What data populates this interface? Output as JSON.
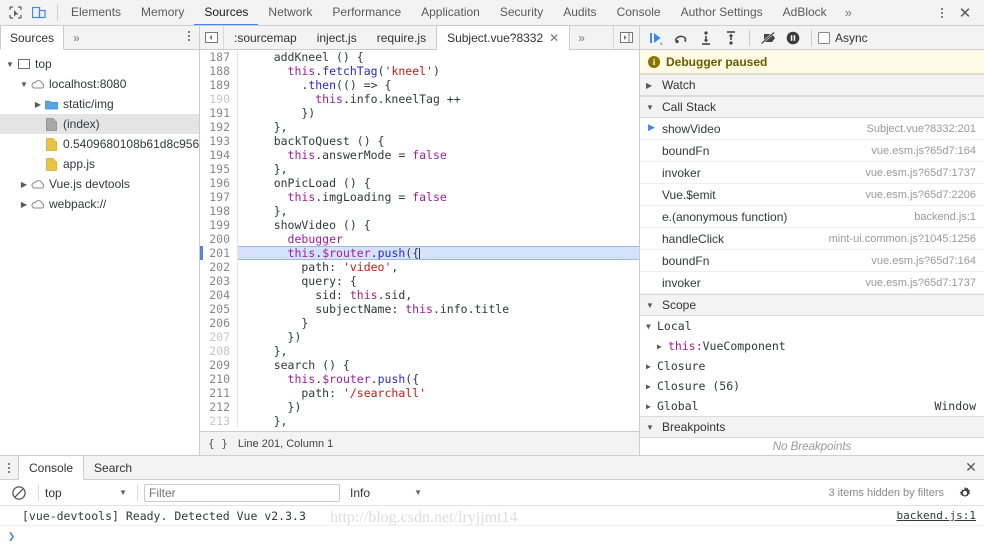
{
  "topbar": {
    "icons": [
      {
        "name": "inspect-element-icon",
        "glyph": "inspect"
      },
      {
        "name": "device-toolbar-icon",
        "glyph": "device"
      }
    ],
    "tabs": [
      {
        "label": "Elements",
        "active": false
      },
      {
        "label": "Memory",
        "active": false
      },
      {
        "label": "Sources",
        "active": true
      },
      {
        "label": "Network",
        "active": false
      },
      {
        "label": "Performance",
        "active": false
      },
      {
        "label": "Application",
        "active": false
      },
      {
        "label": "Security",
        "active": false
      },
      {
        "label": "Audits",
        "active": false
      },
      {
        "label": "Console",
        "active": false
      },
      {
        "label": "Author Settings",
        "active": false
      },
      {
        "label": "AdBlock",
        "active": false
      }
    ],
    "overflow_label": "»",
    "close_label": "✕"
  },
  "navigator": {
    "tabs": [
      {
        "label": "Sources",
        "active": true
      },
      {
        "label": "»",
        "active": false
      }
    ],
    "tree": [
      {
        "label": "top",
        "depth": 0,
        "twisty": "▼",
        "icon": "frame-icon",
        "selected": false
      },
      {
        "label": "localhost:8080",
        "depth": 1,
        "twisty": "▼",
        "icon": "cloud-icon",
        "selected": false
      },
      {
        "label": "static/img",
        "depth": 2,
        "twisty": "▶",
        "icon": "folder-blue-icon",
        "selected": false
      },
      {
        "label": "(index)",
        "depth": 2,
        "twisty": "",
        "icon": "document-gray-icon",
        "selected": true
      },
      {
        "label": "0.5409680108b61d8c956",
        "depth": 2,
        "twisty": "",
        "icon": "script-yellow-icon",
        "selected": false
      },
      {
        "label": "app.js",
        "depth": 2,
        "twisty": "",
        "icon": "script-yellow-icon",
        "selected": false
      },
      {
        "label": "Vue.js devtools",
        "depth": 1,
        "twisty": "▶",
        "icon": "cloud-icon",
        "selected": false
      },
      {
        "label": "webpack://",
        "depth": 1,
        "twisty": "▶",
        "icon": "cloud-icon",
        "selected": false
      }
    ]
  },
  "editor": {
    "tabs": [
      {
        "label": ":sourcemap",
        "active": false,
        "closable": false
      },
      {
        "label": "inject.js",
        "active": false,
        "closable": false
      },
      {
        "label": "require.js",
        "active": false,
        "closable": false
      },
      {
        "label": "Subject.vue?8332",
        "active": true,
        "closable": true
      }
    ],
    "tab_close_glyph": "✕",
    "tab_overflow_label": "»",
    "status": {
      "pretty_print_label": "{ }",
      "position_label": "Line 201, Column 1"
    },
    "lines": [
      {
        "n": 187,
        "dim": false,
        "hl": false,
        "tokens": [
          {
            "t": "    addKneel () {",
            "c": "kw"
          }
        ]
      },
      {
        "n": 188,
        "dim": false,
        "hl": false,
        "tokens": [
          {
            "t": "      ",
            "c": "kw"
          },
          {
            "t": "this",
            "c": "pp"
          },
          {
            "t": ".",
            "c": "kw"
          },
          {
            "t": "fetchTag",
            "c": "fn"
          },
          {
            "t": "(",
            "c": "kw"
          },
          {
            "t": "'kneel'",
            "c": "st"
          },
          {
            "t": ")",
            "c": "kw"
          }
        ]
      },
      {
        "n": 189,
        "dim": false,
        "hl": false,
        "tokens": [
          {
            "t": "        .",
            "c": "kw"
          },
          {
            "t": "then",
            "c": "fn"
          },
          {
            "t": "(() => {",
            "c": "kw"
          }
        ]
      },
      {
        "n": 190,
        "dim": true,
        "hl": false,
        "tokens": [
          {
            "t": "          ",
            "c": "kw"
          },
          {
            "t": "this",
            "c": "pp"
          },
          {
            "t": ".info.kneelTag ++",
            "c": "kw"
          }
        ]
      },
      {
        "n": 191,
        "dim": false,
        "hl": false,
        "tokens": [
          {
            "t": "        })",
            "c": "kw"
          }
        ]
      },
      {
        "n": 192,
        "dim": false,
        "hl": false,
        "tokens": [
          {
            "t": "    },",
            "c": "kw"
          }
        ]
      },
      {
        "n": 193,
        "dim": false,
        "hl": false,
        "tokens": [
          {
            "t": "    backToQuest () {",
            "c": "kw"
          }
        ]
      },
      {
        "n": 194,
        "dim": false,
        "hl": false,
        "tokens": [
          {
            "t": "      ",
            "c": "kw"
          },
          {
            "t": "this",
            "c": "pp"
          },
          {
            "t": ".answerMode = ",
            "c": "kw"
          },
          {
            "t": "false",
            "c": "pp"
          }
        ]
      },
      {
        "n": 195,
        "dim": false,
        "hl": false,
        "tokens": [
          {
            "t": "    },",
            "c": "kw"
          }
        ]
      },
      {
        "n": 196,
        "dim": false,
        "hl": false,
        "tokens": [
          {
            "t": "    onPicLoad () {",
            "c": "kw"
          }
        ]
      },
      {
        "n": 197,
        "dim": false,
        "hl": false,
        "tokens": [
          {
            "t": "      ",
            "c": "kw"
          },
          {
            "t": "this",
            "c": "pp"
          },
          {
            "t": ".imgLoading = ",
            "c": "kw"
          },
          {
            "t": "false",
            "c": "pp"
          }
        ]
      },
      {
        "n": 198,
        "dim": false,
        "hl": false,
        "tokens": [
          {
            "t": "    },",
            "c": "kw"
          }
        ]
      },
      {
        "n": 199,
        "dim": false,
        "hl": false,
        "tokens": [
          {
            "t": "    showVideo () {",
            "c": "kw"
          }
        ]
      },
      {
        "n": 200,
        "dim": false,
        "hl": false,
        "tokens": [
          {
            "t": "      ",
            "c": "kw"
          },
          {
            "t": "debugger",
            "c": "pp"
          }
        ]
      },
      {
        "n": 201,
        "dim": false,
        "hl": true,
        "tokens": [
          {
            "t": "      ",
            "c": "kw"
          },
          {
            "t": "this",
            "c": "pp"
          },
          {
            "t": ".",
            "c": "kw"
          },
          {
            "t": "$router",
            "c": "pp"
          },
          {
            "t": ".",
            "c": "kw"
          },
          {
            "t": "push",
            "c": "fn"
          },
          {
            "t": "({",
            "c": "kw"
          }
        ]
      },
      {
        "n": 202,
        "dim": false,
        "hl": false,
        "tokens": [
          {
            "t": "        path: ",
            "c": "kw"
          },
          {
            "t": "'video'",
            "c": "st"
          },
          {
            "t": ",",
            "c": "kw"
          }
        ]
      },
      {
        "n": 203,
        "dim": false,
        "hl": false,
        "tokens": [
          {
            "t": "        query: {",
            "c": "kw"
          }
        ]
      },
      {
        "n": 204,
        "dim": false,
        "hl": false,
        "tokens": [
          {
            "t": "          sid: ",
            "c": "kw"
          },
          {
            "t": "this",
            "c": "pp"
          },
          {
            "t": ".sid,",
            "c": "kw"
          }
        ]
      },
      {
        "n": 205,
        "dim": false,
        "hl": false,
        "tokens": [
          {
            "t": "          subjectName: ",
            "c": "kw"
          },
          {
            "t": "this",
            "c": "pp"
          },
          {
            "t": ".info.title",
            "c": "kw"
          }
        ]
      },
      {
        "n": 206,
        "dim": false,
        "hl": false,
        "tokens": [
          {
            "t": "        }",
            "c": "kw"
          }
        ]
      },
      {
        "n": 207,
        "dim": true,
        "hl": false,
        "tokens": [
          {
            "t": "      })",
            "c": "kw"
          }
        ]
      },
      {
        "n": 208,
        "dim": true,
        "hl": false,
        "tokens": [
          {
            "t": "    },",
            "c": "kw"
          }
        ]
      },
      {
        "n": 209,
        "dim": false,
        "hl": false,
        "tokens": [
          {
            "t": "    search () {",
            "c": "kw"
          }
        ]
      },
      {
        "n": 210,
        "dim": false,
        "hl": false,
        "tokens": [
          {
            "t": "      ",
            "c": "kw"
          },
          {
            "t": "this",
            "c": "pp"
          },
          {
            "t": ".",
            "c": "kw"
          },
          {
            "t": "$router",
            "c": "pp"
          },
          {
            "t": ".",
            "c": "kw"
          },
          {
            "t": "push",
            "c": "fn"
          },
          {
            "t": "({",
            "c": "kw"
          }
        ]
      },
      {
        "n": 211,
        "dim": false,
        "hl": false,
        "tokens": [
          {
            "t": "        path: ",
            "c": "kw"
          },
          {
            "t": "'/searchall'",
            "c": "st"
          }
        ]
      },
      {
        "n": 212,
        "dim": false,
        "hl": false,
        "tokens": [
          {
            "t": "      })",
            "c": "kw"
          }
        ]
      },
      {
        "n": 213,
        "dim": true,
        "hl": false,
        "tokens": [
          {
            "t": "    },",
            "c": "kw"
          }
        ]
      }
    ]
  },
  "debugger": {
    "toolbar": [
      {
        "name": "resume-script-button",
        "title": "Resume script execution"
      },
      {
        "name": "step-over-button",
        "title": "Step over next function call"
      },
      {
        "name": "step-into-button",
        "title": "Step into next function call"
      },
      {
        "name": "step-out-button",
        "title": "Step out of current function"
      },
      {
        "name": "deactivate-breakpoints-button",
        "title": "Deactivate breakpoints"
      },
      {
        "name": "pause-on-exceptions-button",
        "title": "Pause on exceptions"
      }
    ],
    "async_label": "Async",
    "async_checked": false,
    "paused_message": "Debugger paused",
    "sections": {
      "watch": {
        "label": "Watch",
        "expanded": false,
        "tri": "▶"
      },
      "call_stack": {
        "label": "Call Stack",
        "expanded": true,
        "tri": "▼"
      },
      "scope": {
        "label": "Scope",
        "expanded": true,
        "tri": "▼"
      },
      "breakpoints": {
        "label": "Breakpoints",
        "expanded": true,
        "tri": "▼",
        "empty_text": "No Breakpoints"
      }
    },
    "call_stack": [
      {
        "fn": "showVideo",
        "loc": "Subject.vue?8332:201",
        "current": true
      },
      {
        "fn": "boundFn",
        "loc": "vue.esm.js?65d7:164",
        "current": false
      },
      {
        "fn": "invoker",
        "loc": "vue.esm.js?65d7:1737",
        "current": false
      },
      {
        "fn": "Vue.$emit",
        "loc": "vue.esm.js?65d7:2206",
        "current": false
      },
      {
        "fn": "e.(anonymous function)",
        "loc": "backend.js:1",
        "current": false
      },
      {
        "fn": "handleClick",
        "loc": "mint-ui.common.js?1045:1256",
        "current": false
      },
      {
        "fn": "boundFn",
        "loc": "vue.esm.js?65d7:164",
        "current": false
      },
      {
        "fn": "invoker",
        "loc": "vue.esm.js?65d7:1737",
        "current": false
      }
    ],
    "scope": [
      {
        "label": "Local",
        "tri": "▼",
        "depth": 0,
        "key": "",
        "value": ""
      },
      {
        "label": "",
        "tri": "▶",
        "depth": 1,
        "key": "this:",
        "value_inline": "VueComponent"
      },
      {
        "label": "Closure",
        "tri": "▶",
        "depth": 0,
        "key": "",
        "value": ""
      },
      {
        "label": "Closure (56)",
        "tri": "▶",
        "depth": 0,
        "key": "",
        "value": ""
      },
      {
        "label": "Global",
        "tri": "▶",
        "depth": 0,
        "key": "",
        "value": "Window"
      }
    ]
  },
  "drawer": {
    "tabs": [
      {
        "label": "Console",
        "active": true
      },
      {
        "label": "Search",
        "active": false
      }
    ],
    "close_label": "✕",
    "console_bar": {
      "clear_icon": "no-entry-icon",
      "context": "top",
      "caret": "▼",
      "filter_placeholder": "Filter",
      "filter_value": "",
      "level": "Info",
      "hidden_note": "3 items hidden by filters",
      "gear_icon": "gear-icon"
    },
    "messages": [
      {
        "text": "[vue-devtools] Ready. Detected Vue v2.3.3",
        "source": "backend.js:1"
      }
    ],
    "prompt": "❯",
    "watermark": "http://blog.csdn.net/lryjjmt14"
  },
  "colors": {
    "accent": "#4285f4",
    "paused_bg": "#fffbe5",
    "highlight_line": "#d4e2fc",
    "string": "#c41a16",
    "keyword": "#a020a0",
    "function": "#2a2acc"
  }
}
